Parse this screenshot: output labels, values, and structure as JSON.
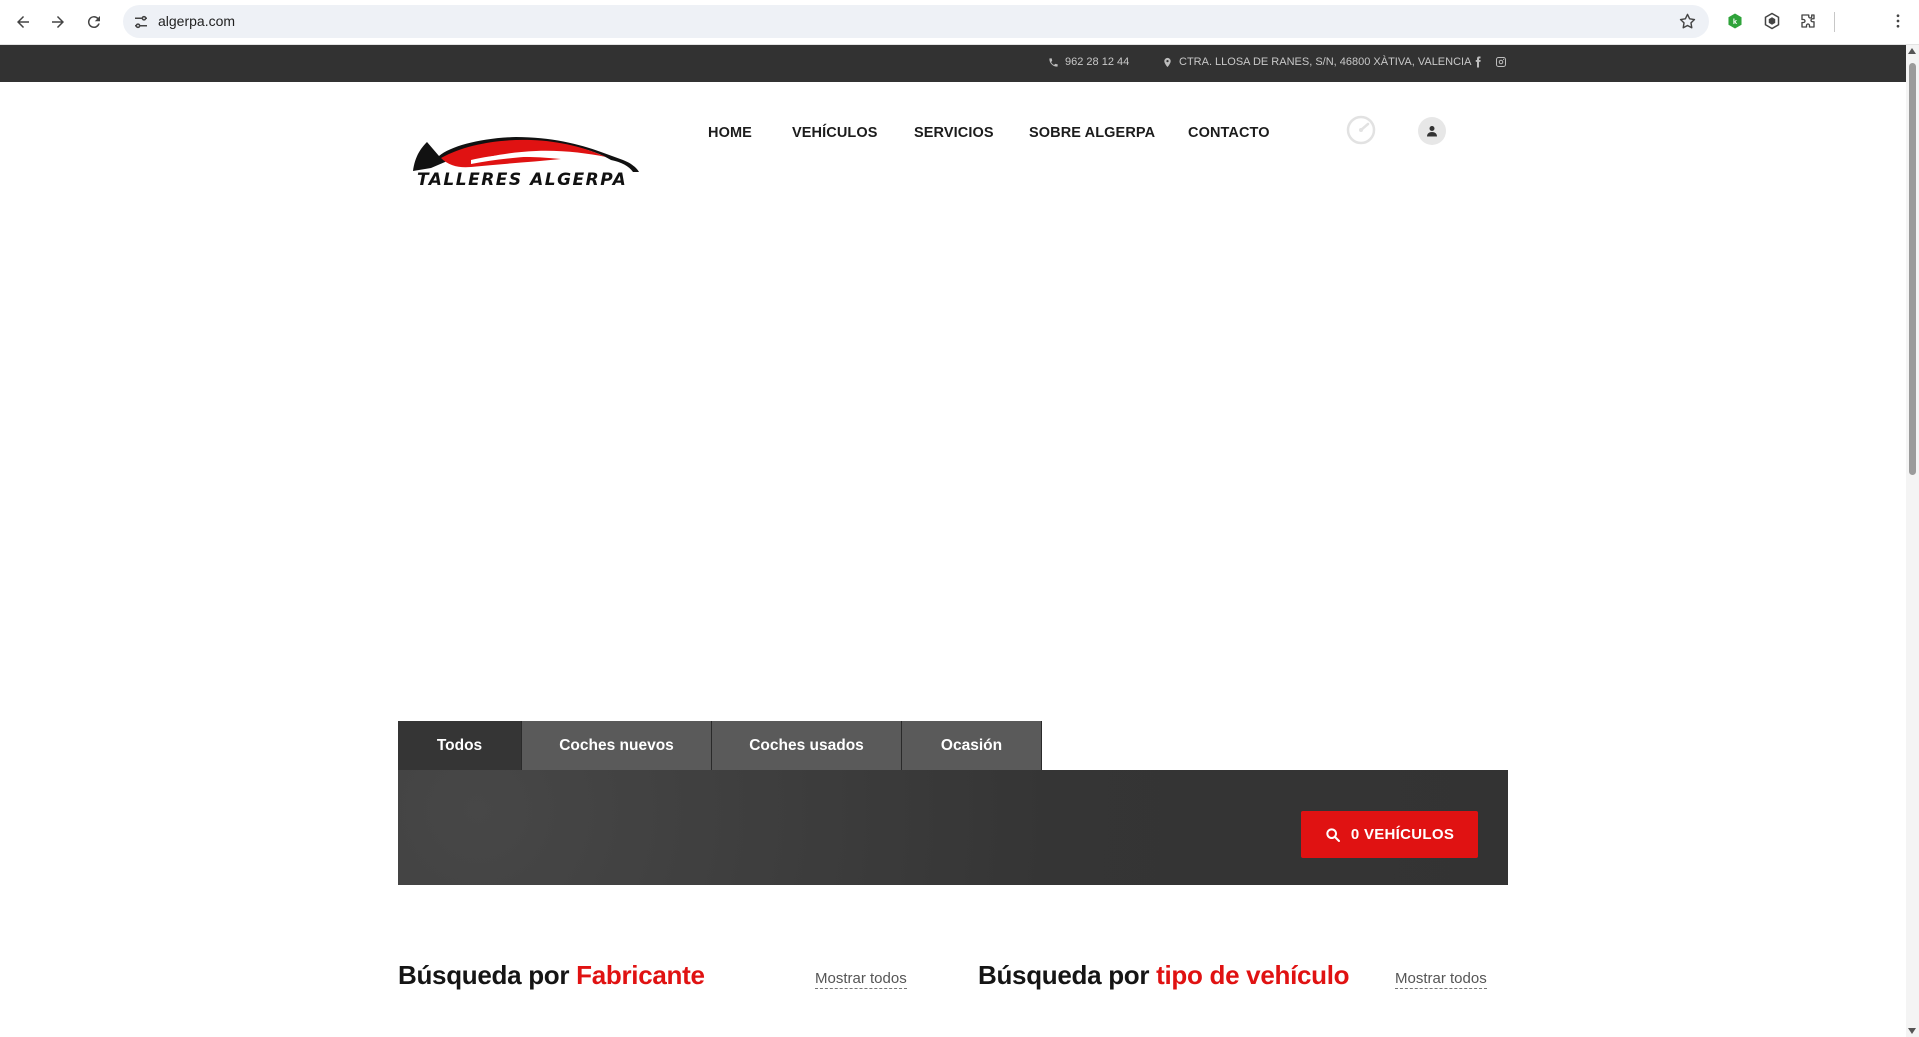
{
  "browser": {
    "url": "algerpa.com"
  },
  "topbar": {
    "phone": "962 28 12 44",
    "address": "CTRA. LLOSA DE RANES, S/N, 46800 XÀTIVA, VALENCIA"
  },
  "logo": {
    "text": "TALLERES ALGERPA"
  },
  "nav": {
    "items": [
      "HOME",
      "VEHÍCULOS",
      "SERVICIOS",
      "SOBRE ALGERPA",
      "CONTACTO"
    ]
  },
  "search": {
    "tabs": [
      "Todos",
      "Coches nuevos",
      "Coches usados",
      "Ocasión"
    ],
    "active_tab": "Todos",
    "button_label": "0 VEHÍCULOS"
  },
  "sections": [
    {
      "title_prefix": "Búsqueda por",
      "title_highlight": "Fabricante",
      "show_all": "Mostrar todos"
    },
    {
      "title_prefix": "Búsqueda por",
      "title_highlight": "tipo de vehículo",
      "show_all": "Mostrar todos"
    }
  ],
  "colors": {
    "accent": "#e01212",
    "dark_bar": "#323232",
    "panel": "#353535"
  }
}
